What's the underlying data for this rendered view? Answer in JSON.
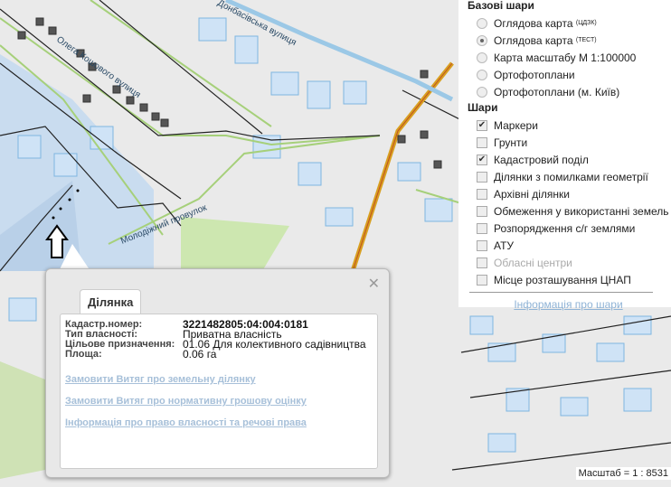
{
  "map": {
    "streets": [
      "Олега Кошового вулиця",
      "Донбасівська вулиця",
      "Молодіжний провулок"
    ],
    "scale_text": "Масштаб = 1 : 8531"
  },
  "layers": {
    "base_title": "Базові шари",
    "base": [
      {
        "label": "Оглядова карта",
        "sup": "(ЦДЗК)",
        "selected": false
      },
      {
        "label": "Оглядова карта",
        "sup": "(ТЕСТ)",
        "selected": true
      },
      {
        "label": "Карта масштабу М 1:100000",
        "sup": "",
        "selected": false
      },
      {
        "label": "Ортофотоплани",
        "sup": "",
        "selected": false
      },
      {
        "label": "Ортофотоплани (м. Київ)",
        "sup": "",
        "selected": false
      }
    ],
    "overlay_title": "Шари",
    "overlays": [
      {
        "label": "Маркери",
        "checked": true
      },
      {
        "label": "Грунти",
        "checked": false
      },
      {
        "label": "Кадастровий поділ",
        "checked": true
      },
      {
        "label": "Ділянки з помилками геометрії",
        "checked": false
      },
      {
        "label": "Архівні ділянки",
        "checked": false
      },
      {
        "label": "Обмеження у використанні земель",
        "checked": false
      },
      {
        "label": "Розпорядження с/г землями",
        "checked": false
      },
      {
        "label": "АТУ",
        "checked": false
      },
      {
        "label": "Обласні центри",
        "checked": false,
        "disabled": true
      },
      {
        "label": "Місце розташування ЦНАП",
        "checked": false
      }
    ],
    "info_link": "Інформація про шари"
  },
  "popup": {
    "tab": "Ділянка",
    "close": "✕",
    "fields": [
      {
        "k": "Кадастр.номер:",
        "v": "3221482805:04:004:0181"
      },
      {
        "k": "Тип власності:",
        "v": "Приватна власність"
      },
      {
        "k": "Цільове призначення:",
        "v": "01.06 Для колективного садівництва"
      },
      {
        "k": "Площа:",
        "v": "0.06 га"
      }
    ],
    "links": [
      "Замовити Витяг про земельну ділянку",
      "Замовити Витяг про нормативну грошову оцінку",
      "Інформація про право власності та речові права"
    ]
  }
}
